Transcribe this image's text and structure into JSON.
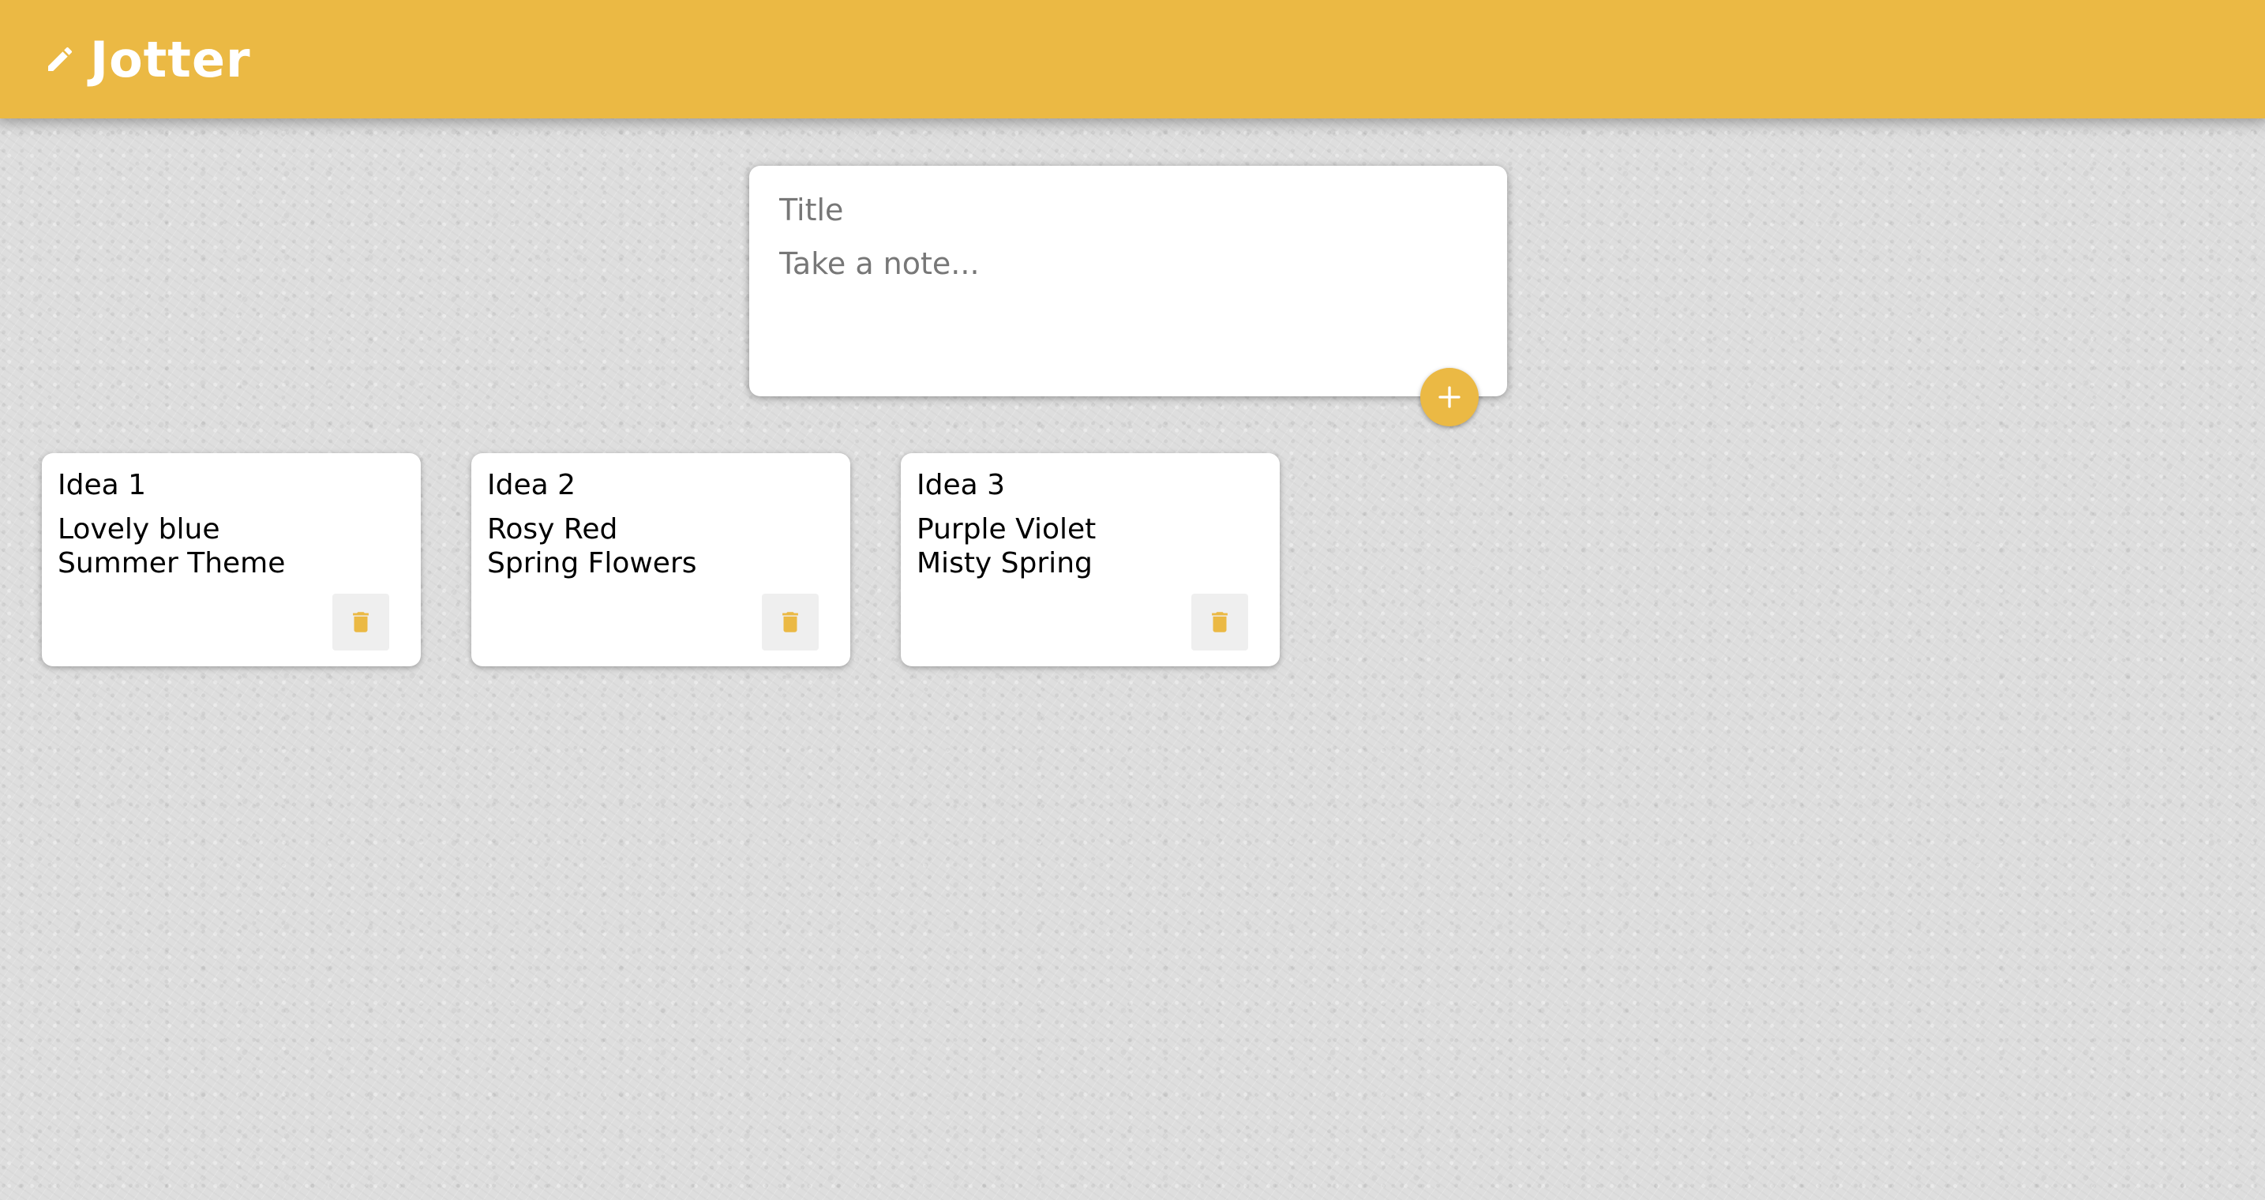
{
  "colors": {
    "accent": "#ebb944",
    "header_text": "#ffffff",
    "card_background": "#ffffff",
    "delete_button_background": "#efefef"
  },
  "header": {
    "title": "Jotter",
    "icon": "pencil-icon"
  },
  "create_note": {
    "title_placeholder": "Title",
    "content_placeholder": "Take a note...",
    "add_icon": "plus-icon"
  },
  "notes": [
    {
      "title": "Idea 1",
      "content": "Lovely blue\nSummer Theme",
      "delete_icon": "trash-icon"
    },
    {
      "title": "Idea 2",
      "content": "Rosy Red\nSpring Flowers",
      "delete_icon": "trash-icon"
    },
    {
      "title": "Idea 3",
      "content": "Purple Violet\nMisty Spring",
      "delete_icon": "trash-icon"
    }
  ]
}
